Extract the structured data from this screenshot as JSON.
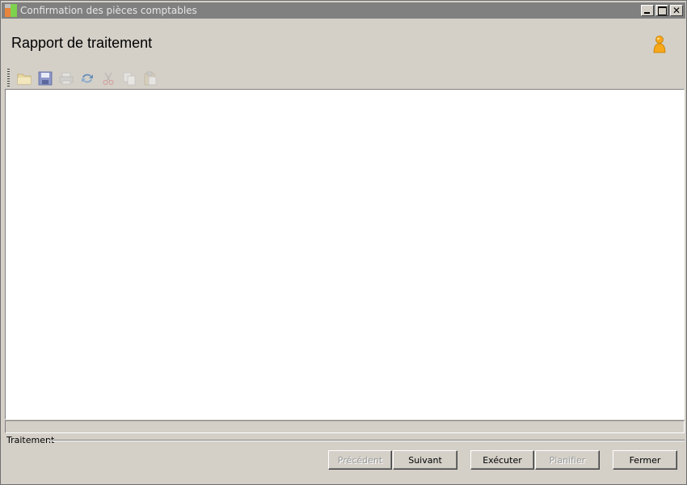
{
  "window": {
    "title": "Confirmation des pièces comptables",
    "controls": [
      "minimize",
      "maximize",
      "close"
    ]
  },
  "header": {
    "title": "Rapport de traitement",
    "user_icon": "user-icon"
  },
  "toolbar": {
    "tools": [
      {
        "name": "open-folder-icon",
        "enabled": true
      },
      {
        "name": "save-icon",
        "enabled": true
      },
      {
        "name": "print-icon",
        "enabled": false
      },
      {
        "name": "refresh-icon",
        "enabled": true
      },
      {
        "name": "cut-icon",
        "enabled": false
      },
      {
        "name": "copy-icon",
        "enabled": false
      },
      {
        "name": "paste-icon",
        "enabled": false
      }
    ]
  },
  "report": {
    "content": ""
  },
  "progress": {
    "value": 0
  },
  "group": {
    "label": "Traitement"
  },
  "buttons": {
    "previous": {
      "label": "Précédent",
      "enabled": false
    },
    "next": {
      "label": "Suivant",
      "enabled": true
    },
    "execute": {
      "label": "Exécuter",
      "enabled": true
    },
    "schedule": {
      "label": "Planifier",
      "enabled": false
    },
    "close": {
      "label": "Fermer",
      "enabled": true
    }
  },
  "colors": {
    "face": "#d4d0c8",
    "title_bar": "#808080",
    "title_text": "#e6e6e6",
    "disabled_text": "#9a9a9a"
  }
}
